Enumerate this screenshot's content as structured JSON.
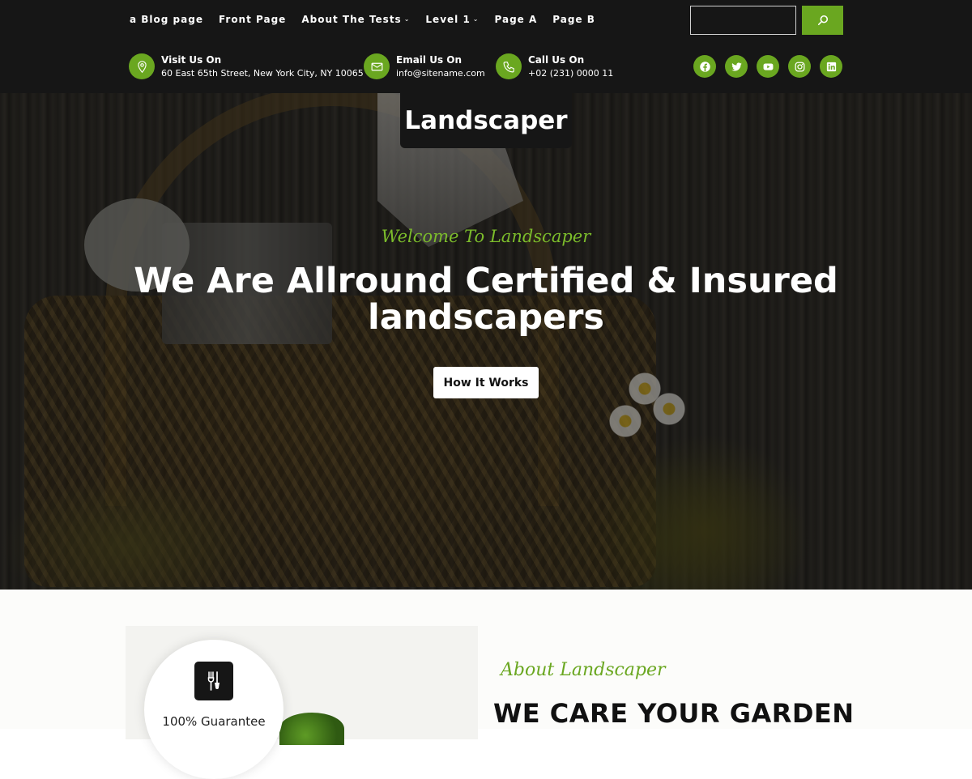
{
  "nav": {
    "items": [
      {
        "label": "a Blog page",
        "has_dropdown": false
      },
      {
        "label": "Front Page",
        "has_dropdown": false
      },
      {
        "label": "About The Tests",
        "has_dropdown": true
      },
      {
        "label": "Level 1",
        "has_dropdown": true
      },
      {
        "label": "Page A",
        "has_dropdown": false
      },
      {
        "label": "Page B",
        "has_dropdown": false
      }
    ],
    "search_value": "",
    "search_icon": "search-icon"
  },
  "contact": {
    "visit": {
      "title": "Visit Us On",
      "text": "60 East 65th Street, New York City, NY 10065",
      "icon": "map-pin-icon"
    },
    "email": {
      "title": "Email Us On",
      "text": "info@sitename.com",
      "icon": "envelope-icon"
    },
    "call": {
      "title": "Call Us On",
      "text": "+02 (231) 0000 11",
      "icon": "phone-icon"
    }
  },
  "socials": [
    "facebook-icon",
    "twitter-icon",
    "youtube-icon",
    "instagram-icon",
    "linkedin-icon"
  ],
  "site": {
    "title": "Landscaper"
  },
  "hero": {
    "welcome": "Welcome To Landscaper",
    "headline": "We Are Allround Certified & Insured landscapers",
    "button": "How It Works"
  },
  "about": {
    "badge_text": "100% Guarantee",
    "subtitle": "About Landscaper",
    "title": "WE CARE YOUR GARDEN"
  },
  "colors": {
    "accent": "#6aa720",
    "header_bg": "#161616",
    "script_green": "#7cbd2b"
  }
}
